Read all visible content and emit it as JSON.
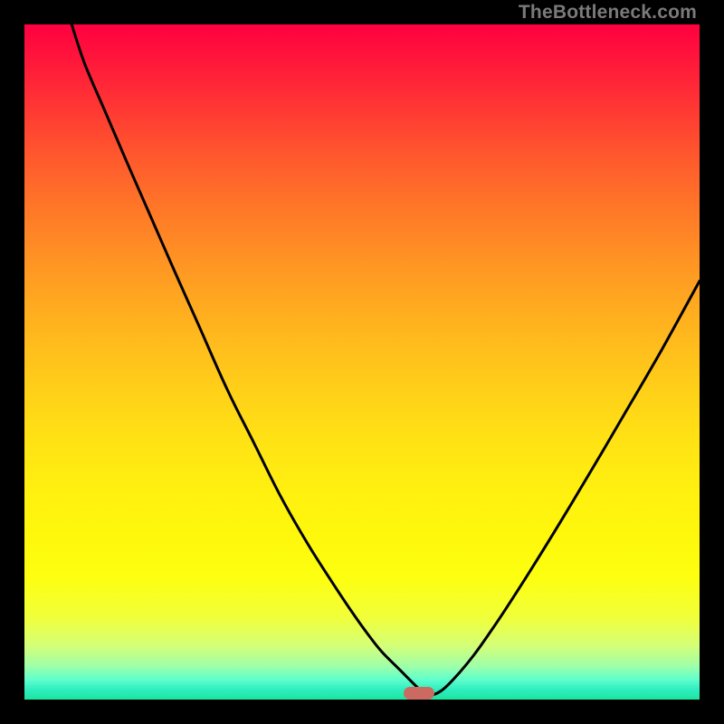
{
  "watermark": "TheBottleneck.com",
  "colors": {
    "frame": "#000000",
    "curve": "#000000",
    "marker": "#cb6a60"
  },
  "chart_data": {
    "type": "line",
    "title": "",
    "xlabel": "",
    "ylabel": "",
    "xlim": [
      0,
      100
    ],
    "ylim": [
      0,
      100
    ],
    "grid": false,
    "legend": false,
    "note": "X and Y are normalized to 0–100 of plot area; Y=0 is top, Y=100 is bottom baseline.",
    "series": [
      {
        "name": "bottleneck-curve",
        "x": [
          7.0,
          9.0,
          12.0,
          15.0,
          18.5,
          22.0,
          26.0,
          30.0,
          34.0,
          38.0,
          42.0,
          45.5,
          48.5,
          51.0,
          53.0,
          55.0,
          56.5,
          57.7,
          58.6,
          59.3,
          60.5,
          62.0,
          64.0,
          66.5,
          69.0,
          72.0,
          75.5,
          79.5,
          84.0,
          89.0,
          94.5,
          100.0
        ],
        "y": [
          0.0,
          6.0,
          13.0,
          20.0,
          28.0,
          36.0,
          45.0,
          54.0,
          62.0,
          70.0,
          77.0,
          82.5,
          87.0,
          90.5,
          93.0,
          95.0,
          96.5,
          97.7,
          98.6,
          99.3,
          99.3,
          98.5,
          96.5,
          93.5,
          90.0,
          85.5,
          80.0,
          73.5,
          66.0,
          57.5,
          48.0,
          38.0
        ]
      }
    ],
    "annotations": [
      {
        "name": "min-marker",
        "x": 58.5,
        "y": 99.1,
        "shape": "rounded-bar"
      }
    ]
  }
}
